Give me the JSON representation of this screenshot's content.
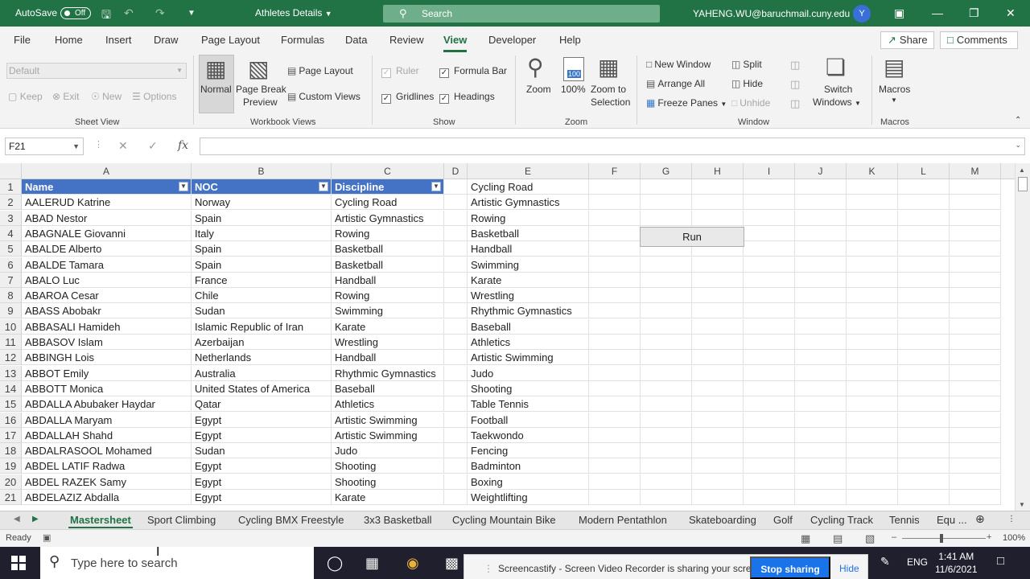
{
  "titlebar": {
    "autosave_label": "AutoSave",
    "autosave_state": "Off",
    "doc_title": "Athletes Details",
    "search_placeholder": "Search",
    "user_email": "YAHENG.WU@baruchmail.cuny.edu",
    "avatar_initial": "Y"
  },
  "tabs": [
    "File",
    "Home",
    "Insert",
    "Draw",
    "Page Layout",
    "Formulas",
    "Data",
    "Review",
    "View",
    "Developer",
    "Help"
  ],
  "active_tab": "View",
  "share_label": "Share",
  "comments_label": "Comments",
  "ribbon": {
    "sheet_view": {
      "dropdown_value": "Default",
      "keep": "Keep",
      "exit": "Exit",
      "new": "New",
      "options": "Options",
      "label": "Sheet View"
    },
    "workbook_views": {
      "normal": "Normal",
      "page_break_1": "Page Break",
      "page_break_2": "Preview",
      "page_layout": "Page Layout",
      "custom_views": "Custom Views",
      "label": "Workbook Views"
    },
    "show": {
      "ruler": "Ruler",
      "formula_bar": "Formula Bar",
      "gridlines": "Gridlines",
      "headings": "Headings",
      "label": "Show"
    },
    "zoom": {
      "zoom": "Zoom",
      "hundred": "100%",
      "zoom_sel_1": "Zoom to",
      "zoom_sel_2": "Selection",
      "label": "Zoom",
      "icon_100": "100"
    },
    "window": {
      "new_window": "New Window",
      "arrange_all": "Arrange All",
      "freeze_panes": "Freeze Panes",
      "split": "Split",
      "hide": "Hide",
      "unhide": "Unhide",
      "switch_1": "Switch",
      "switch_2": "Windows",
      "label": "Window"
    },
    "macros": {
      "macros": "Macros",
      "label": "Macros"
    }
  },
  "formula_bar": {
    "name_box": "F21",
    "fx": "fx"
  },
  "columns": [
    "A",
    "B",
    "C",
    "D",
    "E",
    "F",
    "G",
    "H",
    "I",
    "J",
    "K",
    "L",
    "M"
  ],
  "table_headers": [
    "Name",
    "NOC",
    "Discipline"
  ],
  "rows": [
    {
      "n": "1",
      "a": "",
      "b": "",
      "c": "",
      "e": "Cycling Road"
    },
    {
      "n": "2",
      "a": "AALERUD Katrine",
      "b": "Norway",
      "c": "Cycling Road",
      "e": "Artistic Gymnastics"
    },
    {
      "n": "3",
      "a": "ABAD Nestor",
      "b": "Spain",
      "c": "Artistic Gymnastics",
      "e": "Rowing"
    },
    {
      "n": "4",
      "a": "ABAGNALE Giovanni",
      "b": "Italy",
      "c": "Rowing",
      "e": "Basketball"
    },
    {
      "n": "5",
      "a": "ABALDE Alberto",
      "b": "Spain",
      "c": "Basketball",
      "e": "Handball"
    },
    {
      "n": "6",
      "a": "ABALDE Tamara",
      "b": "Spain",
      "c": "Basketball",
      "e": "Swimming"
    },
    {
      "n": "7",
      "a": "ABALO Luc",
      "b": "France",
      "c": "Handball",
      "e": "Karate"
    },
    {
      "n": "8",
      "a": "ABAROA Cesar",
      "b": "Chile",
      "c": "Rowing",
      "e": "Wrestling"
    },
    {
      "n": "9",
      "a": "ABASS Abobakr",
      "b": "Sudan",
      "c": "Swimming",
      "e": "Rhythmic Gymnastics"
    },
    {
      "n": "10",
      "a": "ABBASALI Hamideh",
      "b": "Islamic Republic of Iran",
      "c": "Karate",
      "e": "Baseball"
    },
    {
      "n": "11",
      "a": "ABBASOV Islam",
      "b": "Azerbaijan",
      "c": "Wrestling",
      "e": "Athletics"
    },
    {
      "n": "12",
      "a": "ABBINGH Lois",
      "b": "Netherlands",
      "c": "Handball",
      "e": "Artistic Swimming"
    },
    {
      "n": "13",
      "a": "ABBOT Emily",
      "b": "Australia",
      "c": "Rhythmic Gymnastics",
      "e": "Judo"
    },
    {
      "n": "14",
      "a": "ABBOTT Monica",
      "b": "United States of America",
      "c": "Baseball",
      "e": "Shooting"
    },
    {
      "n": "15",
      "a": "ABDALLA Abubaker Haydar",
      "b": "Qatar",
      "c": "Athletics",
      "e": "Table Tennis"
    },
    {
      "n": "16",
      "a": "ABDALLA Maryam",
      "b": "Egypt",
      "c": "Artistic Swimming",
      "e": "Football"
    },
    {
      "n": "17",
      "a": "ABDALLAH Shahd",
      "b": "Egypt",
      "c": "Artistic Swimming",
      "e": "Taekwondo"
    },
    {
      "n": "18",
      "a": "ABDALRASOOL Mohamed",
      "b": "Sudan",
      "c": "Judo",
      "e": "Fencing"
    },
    {
      "n": "19",
      "a": "ABDEL LATIF Radwa",
      "b": "Egypt",
      "c": "Shooting",
      "e": "Badminton"
    },
    {
      "n": "20",
      "a": "ABDEL RAZEK Samy",
      "b": "Egypt",
      "c": "Shooting",
      "e": "Boxing"
    },
    {
      "n": "21",
      "a": "ABDELAZIZ Abdalla",
      "b": "Egypt",
      "c": "Karate",
      "e": "Weightlifting"
    }
  ],
  "run_button": "Run",
  "sheet_tabs": [
    "Mastersheet",
    "Sport Climbing",
    "Cycling BMX Freestyle",
    "3x3 Basketball",
    "Cycling Mountain Bike",
    "Modern Pentathlon",
    "Skateboarding",
    "Golf",
    "Cycling Track",
    "Tennis",
    "Equ ..."
  ],
  "active_sheet": "Mastersheet",
  "status": {
    "ready": "Ready",
    "zoom": "100%"
  },
  "taskbar": {
    "search_placeholder": "Type here to search",
    "share_banner_text": "Screencastify - Screen Video Recorder is sharing your screen.",
    "stop_sharing": "Stop sharing",
    "hide": "Hide",
    "lang": "ENG",
    "time": "1:41 AM",
    "date": "11/6/2021"
  },
  "colors": {
    "excel_green": "#217346",
    "table_header_blue": "#4472c4",
    "chrome_blue": "#1a73e8"
  }
}
